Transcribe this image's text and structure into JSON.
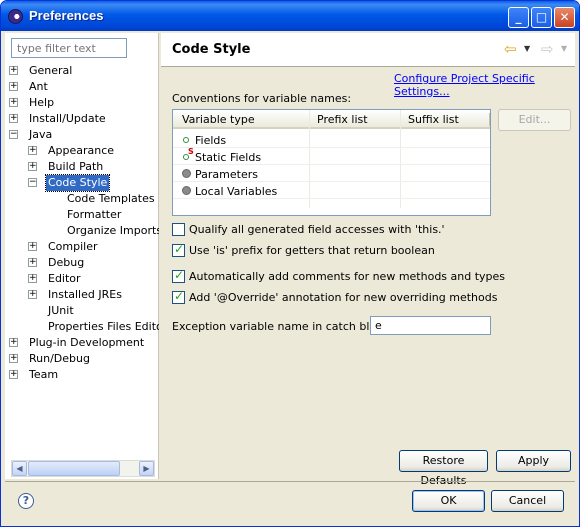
{
  "window": {
    "title": "Preferences"
  },
  "filter": {
    "placeholder": "type filter text"
  },
  "tree": [
    {
      "label": "General",
      "expander": "+",
      "indent": 0
    },
    {
      "label": "Ant",
      "expander": "+",
      "indent": 0
    },
    {
      "label": "Help",
      "expander": "+",
      "indent": 0
    },
    {
      "label": "Install/Update",
      "expander": "+",
      "indent": 0
    },
    {
      "label": "Java",
      "expander": "−",
      "indent": 0
    },
    {
      "label": "Appearance",
      "expander": "+",
      "indent": 1
    },
    {
      "label": "Build Path",
      "expander": "+",
      "indent": 1
    },
    {
      "label": "Code Style",
      "expander": "−",
      "indent": 1,
      "selected": true
    },
    {
      "label": "Code Templates",
      "expander": "",
      "indent": 2
    },
    {
      "label": "Formatter",
      "expander": "",
      "indent": 2
    },
    {
      "label": "Organize Imports",
      "expander": "",
      "indent": 2
    },
    {
      "label": "Compiler",
      "expander": "+",
      "indent": 1
    },
    {
      "label": "Debug",
      "expander": "+",
      "indent": 1
    },
    {
      "label": "Editor",
      "expander": "+",
      "indent": 1
    },
    {
      "label": "Installed JREs",
      "expander": "+",
      "indent": 1
    },
    {
      "label": "JUnit",
      "expander": "",
      "indent": 1
    },
    {
      "label": "Properties Files Edito",
      "expander": "",
      "indent": 1
    },
    {
      "label": "Plug-in Development",
      "expander": "+",
      "indent": 0
    },
    {
      "label": "Run/Debug",
      "expander": "+",
      "indent": 0
    },
    {
      "label": "Team",
      "expander": "+",
      "indent": 0
    }
  ],
  "page": {
    "title": "Code Style",
    "configure_link": "Configure Project Specific Settings...",
    "conventions_label": "Conventions for variable names:",
    "table": {
      "headers": [
        "Variable type",
        "Prefix list",
        "Suffix list"
      ],
      "rows": [
        {
          "type": "Fields",
          "prefix": "",
          "suffix": ""
        },
        {
          "type": "Static Fields",
          "prefix": "",
          "suffix": ""
        },
        {
          "type": "Parameters",
          "prefix": "",
          "suffix": ""
        },
        {
          "type": "Local Variables",
          "prefix": "",
          "suffix": ""
        }
      ]
    },
    "edit_button": "Edit...",
    "checkboxes": [
      {
        "label": "Qualify all generated field accesses with 'this.'",
        "checked": false
      },
      {
        "label": "Use 'is' prefix for getters that return boolean",
        "checked": true
      },
      {
        "label": "Automatically add comments for new methods and types",
        "checked": true
      },
      {
        "label": "Add '@Override' annotation for new overriding methods",
        "checked": true
      }
    ],
    "exception_label": "Exception variable name in catch blocks:",
    "exception_value": "e",
    "restore_defaults": "Restore Defaults",
    "apply": "Apply"
  },
  "footer": {
    "ok": "OK",
    "cancel": "Cancel",
    "help_glyph": "?"
  }
}
